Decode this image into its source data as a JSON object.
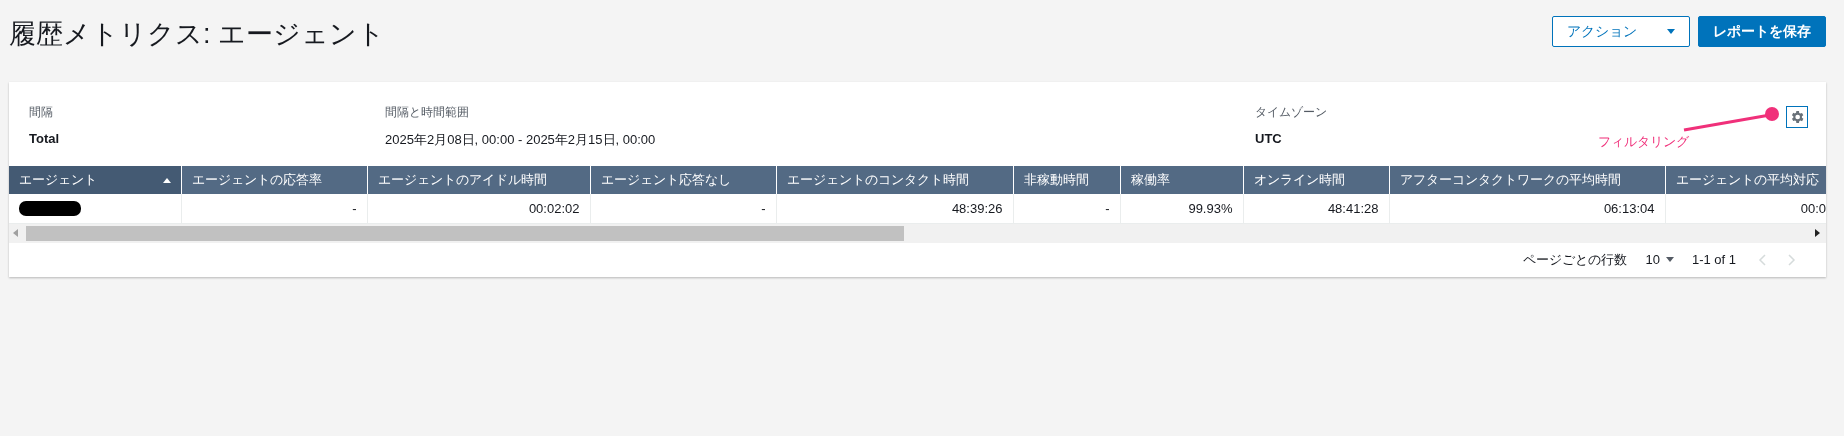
{
  "page": {
    "title": "履歴メトリクス: エージェント"
  },
  "actions": [
    {
      "label": "アクション",
      "kind": "dropdown"
    },
    {
      "label": "レポートを保存",
      "kind": "primary"
    }
  ],
  "summary": [
    {
      "label": "間隔",
      "value": "Total"
    },
    {
      "label": "間隔と時間範囲",
      "value": "2025年2月08日, 00:00 - 2025年2月15日, 00:00"
    },
    {
      "label": "タイムゾーン",
      "value": "UTC"
    }
  ],
  "annotation": {
    "text": "フィルタリング"
  },
  "table": {
    "columns": [
      {
        "label": "エージェント",
        "sorted": true
      },
      {
        "label": "エージェントの応答率",
        "sorted": false
      },
      {
        "label": "エージェントのアイドル時間",
        "sorted": false
      },
      {
        "label": "エージェント応答なし",
        "sorted": false
      },
      {
        "label": "エージェントのコンタクト時間",
        "sorted": false
      },
      {
        "label": "非稼動時間",
        "sorted": false
      },
      {
        "label": "稼働率",
        "sorted": false
      },
      {
        "label": "オンライン時間",
        "sorted": false
      },
      {
        "label": "アフターコンタクトワークの平均時間",
        "sorted": false
      },
      {
        "label": "エージェントの平均対応",
        "sorted": false
      }
    ],
    "rows": [
      {
        "agent_redacted": true,
        "cells": [
          "",
          "-",
          "00:02:02",
          "-",
          "48:39:26",
          "-",
          "99.93%",
          "48:41:28",
          "06:13:04",
          "00:0"
        ]
      }
    ]
  },
  "pagination": {
    "rows_per_page_label": "ページごとの行数",
    "rows_per_page": "10",
    "range": "1-1 of 1",
    "prev_disabled": true,
    "next_disabled": true
  }
}
